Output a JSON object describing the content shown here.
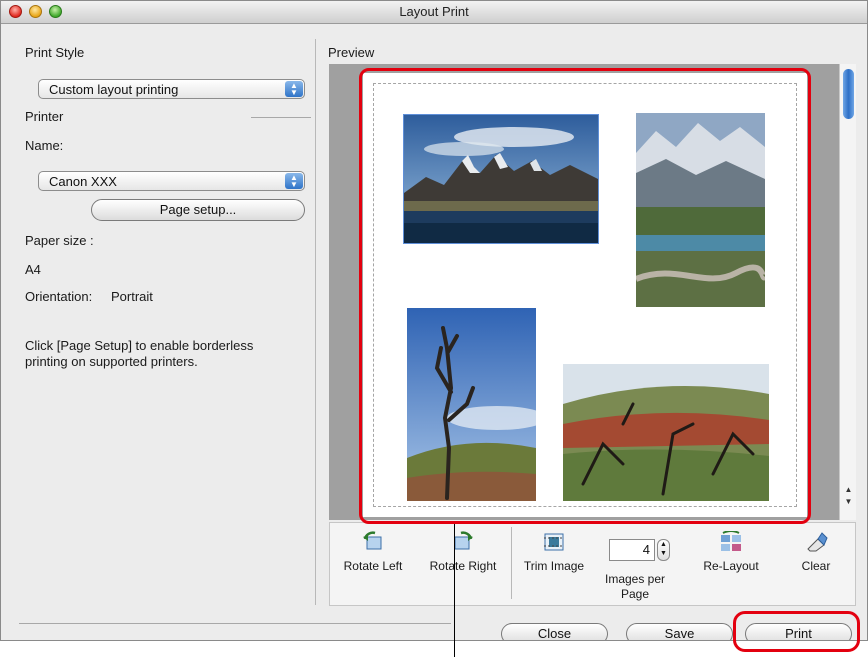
{
  "window": {
    "title": "Layout Print"
  },
  "left_panel": {
    "print_style_label": "Print Style",
    "print_style_value": "Custom layout printing",
    "printer_label": "Printer",
    "name_label": "Name:",
    "printer_value": "Canon XXX",
    "page_setup_button": "Page setup...",
    "paper_size_label": "Paper size :",
    "paper_size_value": "A4",
    "orientation_label": "Orientation:",
    "orientation_value": "Portrait",
    "help_text": "Click [Page Setup] to enable borderless printing on supported printers."
  },
  "preview": {
    "label": "Preview",
    "images": [
      {
        "name": "mountain-lake-photo",
        "selected": true
      },
      {
        "name": "mountain-road-photo",
        "selected": false
      },
      {
        "name": "dead-tree-photo",
        "selected": false
      },
      {
        "name": "hillside-trees-photo",
        "selected": false
      }
    ]
  },
  "toolbar": {
    "rotate_left": "Rotate Left",
    "rotate_right": "Rotate Right",
    "trim_image": "Trim Image",
    "images_per_page_label": "Images per Page",
    "images_per_page_value": "4",
    "re_layout": "Re-Layout",
    "clear": "Clear"
  },
  "footer": {
    "close_button": "Close",
    "save_button": "Save",
    "print_button": "Print"
  },
  "colors": {
    "highlight": "#e3000f",
    "selection": "#5f8fd8",
    "popup_arrow": "#2f74c8"
  }
}
